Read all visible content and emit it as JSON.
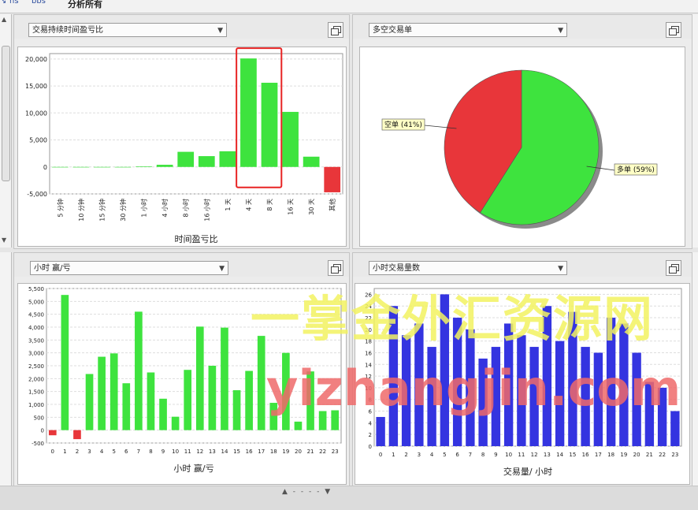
{
  "toolbar": {
    "tab_label": "分析所有",
    "icon_left": "hs",
    "icon_right": "bbs"
  },
  "colors": {
    "positive": "#3ee33e",
    "negative": "#e8363a",
    "volume": "#3434e0",
    "highlight": "#e82424"
  },
  "panels": [
    {
      "selector": "交易持续时间盈亏比",
      "maximize_icon": "window-maximize-icon"
    },
    {
      "selector": "多空交易单",
      "maximize_icon": "window-maximize-icon"
    },
    {
      "selector": "小时 赢/亏",
      "maximize_icon": "window-maximize-icon"
    },
    {
      "selector": "小时交易量数",
      "maximize_icon": "window-maximize-icon"
    }
  ],
  "watermark": {
    "line1": "一掌金外汇资源网",
    "line2": "yizhangjin.com"
  },
  "chart_data": [
    {
      "type": "bar",
      "title": "",
      "xlabel": "时间盈亏比",
      "ylabel": "",
      "categories": [
        "5 分钟",
        "10 分钟",
        "15 分钟",
        "30 分钟",
        "1 小时",
        "4 小时",
        "8 小时",
        "16 小时",
        "1 天",
        "4 天",
        "8 天",
        "16 天",
        "30 天",
        "其他"
      ],
      "values": [
        0,
        0,
        0,
        0,
        100,
        400,
        2800,
        2000,
        2900,
        20100,
        15600,
        10200,
        1900,
        -4700
      ],
      "ylim": [
        -5000,
        21000
      ],
      "yticks": [
        -5000,
        0,
        5000,
        10000,
        15000,
        20000
      ],
      "ytick_labels": [
        "-5,000",
        "0",
        "5,000",
        "10,000",
        "15,000",
        "20,000"
      ],
      "grid": true
    },
    {
      "type": "pie",
      "title": "",
      "slices": [
        {
          "label": "多单",
          "percent_text": "(59%)",
          "value": 59
        },
        {
          "label": "空单",
          "percent_text": "(41%)",
          "value": 41
        }
      ]
    },
    {
      "type": "bar",
      "title": "",
      "xlabel": "小时 赢/亏",
      "ylabel": "",
      "categories": [
        "0",
        "1",
        "2",
        "3",
        "4",
        "5",
        "6",
        "7",
        "8",
        "9",
        "10",
        "11",
        "12",
        "13",
        "14",
        "15",
        "16",
        "17",
        "18",
        "19",
        "20",
        "21",
        "22",
        "23"
      ],
      "values": [
        -200,
        5250,
        -350,
        2180,
        2850,
        2980,
        1820,
        4600,
        2240,
        1220,
        520,
        2340,
        4020,
        2500,
        3980,
        1550,
        2300,
        3660,
        1060,
        3000,
        330,
        2280,
        740,
        770
      ],
      "ylim": [
        -500,
        5500
      ],
      "yticks": [
        -500,
        0,
        500,
        1000,
        1500,
        2000,
        2500,
        3000,
        3500,
        4000,
        4500,
        5000,
        5500
      ],
      "ytick_labels": [
        "-500",
        "0",
        "500",
        "1,000",
        "1,500",
        "2,000",
        "2,500",
        "3,000",
        "3,500",
        "4,000",
        "4,500",
        "5,000",
        "5,500"
      ],
      "grid": true
    },
    {
      "type": "bar",
      "title": "",
      "xlabel": "交易量/ 小时",
      "ylabel": "",
      "categories": [
        "0",
        "1",
        "2",
        "3",
        "4",
        "5",
        "6",
        "7",
        "8",
        "9",
        "10",
        "11",
        "12",
        "13",
        "14",
        "15",
        "16",
        "17",
        "18",
        "19",
        "20",
        "21",
        "22",
        "23"
      ],
      "values": [
        5,
        24,
        19,
        21,
        17,
        26,
        22,
        20,
        15,
        17,
        21,
        19,
        17,
        24,
        18,
        23,
        17,
        16,
        22,
        21,
        16,
        11,
        10,
        6
      ],
      "ylim": [
        0,
        27
      ],
      "yticks": [
        0,
        2,
        4,
        6,
        8,
        10,
        12,
        14,
        16,
        18,
        20,
        22,
        24,
        26
      ],
      "ytick_labels": [
        "0",
        "2",
        "4",
        "6",
        "8",
        "10",
        "12",
        "14",
        "16",
        "18",
        "20",
        "22",
        "24",
        "26"
      ],
      "grid": true
    }
  ]
}
